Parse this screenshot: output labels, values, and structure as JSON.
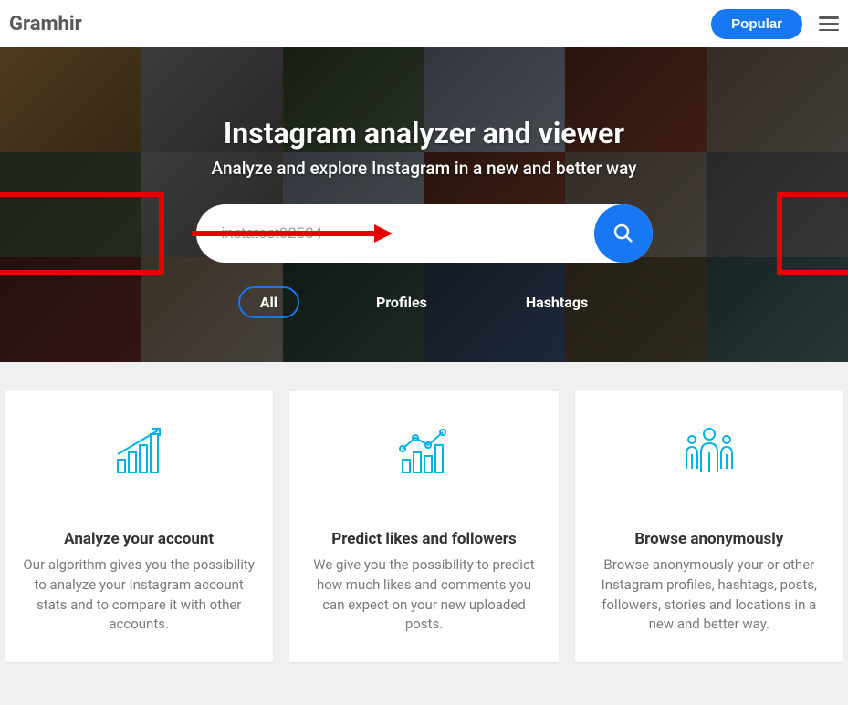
{
  "header": {
    "logo": "Gramhir",
    "popular_label": "Popular"
  },
  "hero": {
    "title": "Instagram analyzer and viewer",
    "subtitle": "Analyze and explore Instagram in a new and better way",
    "search_placeholder": "instatest02584",
    "filters": [
      {
        "label": "All",
        "active": true
      },
      {
        "label": "Profiles",
        "active": false
      },
      {
        "label": "Hashtags",
        "active": false
      }
    ]
  },
  "cards": [
    {
      "title": "Analyze your account",
      "text": "Our algorithm gives you the possibility to analyze your Instagram account stats and to compare it with other accounts."
    },
    {
      "title": "Predict likes and followers",
      "text": "We give you the possibility to predict how much likes and comments you can expect on your new uploaded posts."
    },
    {
      "title": "Browse anonymously",
      "text": "Browse anonymously your or other Instagram profiles, hashtags, posts, followers, stories and locations in a new and better way."
    }
  ],
  "annotation": {
    "highlight_color": "#e60000"
  }
}
